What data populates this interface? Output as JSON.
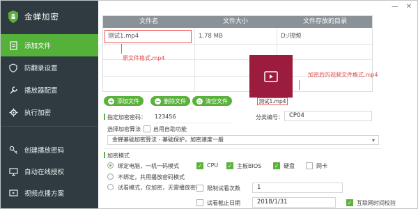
{
  "app": {
    "title": "金蝉加密"
  },
  "sidebar": {
    "items": [
      {
        "label": "添加文件",
        "icon": "add-file-icon",
        "active": true
      },
      {
        "label": "防翻录设置",
        "icon": "shield-icon",
        "active": false
      },
      {
        "label": "播放器配置",
        "icon": "wrench-icon",
        "active": false
      },
      {
        "label": "执行加密",
        "icon": "gear-icon",
        "active": false
      },
      {
        "label": "创建播放密码",
        "icon": "key-icon",
        "active": false
      },
      {
        "label": "自动在线授权",
        "icon": "globe-icon",
        "active": false
      },
      {
        "label": "视频点播方案",
        "icon": "video-icon",
        "active": false
      }
    ]
  },
  "window": {
    "minimize": "—",
    "close": "✕"
  },
  "table": {
    "headers": [
      "文件名",
      "文件大小",
      "文件存放的目录"
    ],
    "rows": [
      {
        "name": "测试1.mp4",
        "size": "1.78 MB",
        "dir": "D:/视频"
      }
    ]
  },
  "annotations": {
    "source": "原文件格式.mp4",
    "encrypted": "加密后的视频文件格式.mp4",
    "video_label": "测试1.mp4"
  },
  "toolbar": {
    "add": "添加文件",
    "delete": "删除文件",
    "clear": "清空文件"
  },
  "form": {
    "password_label": "指定加密密码：",
    "password_value": "123456",
    "category_label": "分类编号：",
    "category_value": "CP04",
    "algo_label": "选择加密算法",
    "algo_option_label": "启用自助功能",
    "algo_select": "金蝉基础加密算法 - 基础保护，加密速度一般",
    "mode_section": "加密模式",
    "modes": [
      {
        "label": "绑定电脑，一机一码模式",
        "selected": true
      },
      {
        "label": "不绑定，共用播放密码模式",
        "selected": false
      },
      {
        "label": "试看模式，仅加密，无需播放密码",
        "selected": false
      }
    ],
    "hw": [
      {
        "label": "CPU",
        "checked": true
      },
      {
        "label": "主板BIOS",
        "checked": true
      },
      {
        "label": "硬盘",
        "checked": true
      },
      {
        "label": "网卡",
        "checked": false
      }
    ],
    "limit_label": "限制试看次数",
    "limit_value": "1",
    "expiry_label": "试看截止日期",
    "expiry_value": "2018/1/31",
    "network_label": "互联网时间校验",
    "network_checked": true
  },
  "colors": {
    "accent": "#5ab23c",
    "sidebar": "#2f3b40",
    "video": "#9b1c3c",
    "annotation": "#e04a4a"
  }
}
